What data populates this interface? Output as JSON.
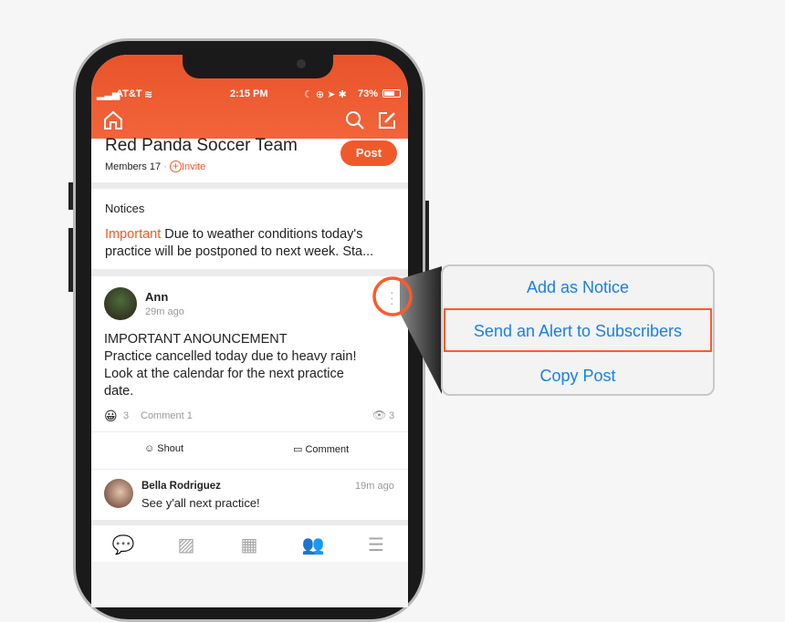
{
  "status": {
    "carrier": "AT&T",
    "time": "2:15 PM",
    "battery": "73%"
  },
  "group": {
    "title": "Red Panda Soccer Team",
    "members": "Members 17",
    "invite": "Invite",
    "post_button": "Post"
  },
  "notices": {
    "heading": "Notices",
    "tag": "Important",
    "text": "Due to weather conditions today's practice will be postponed to next week. Sta..."
  },
  "post": {
    "author": "Ann",
    "time": "29m ago",
    "lines": [
      "IMPORTANT ANOUNCEMENT",
      "Practice cancelled today due to heavy rain!",
      "Look at the calendar for the next practice",
      "date."
    ],
    "reactions": "3",
    "comments": "Comment 1",
    "views": "3",
    "shout": "Shout",
    "comment": "Comment"
  },
  "reply": {
    "author": "Bella Rodriguez",
    "time": "19m ago",
    "text": "See y'all next practice!"
  },
  "menu": {
    "items": [
      "Add as Notice",
      "Send an Alert to Subscribers",
      "Copy Post"
    ],
    "highlighted": 1
  },
  "colors": {
    "accent": "#f05a2a",
    "link": "#1a7fe6",
    "highlight": "#ff5a2b"
  },
  "tabs": [
    "chat-icon",
    "image-icon",
    "calendar-icon",
    "members-icon",
    "menu-icon"
  ]
}
